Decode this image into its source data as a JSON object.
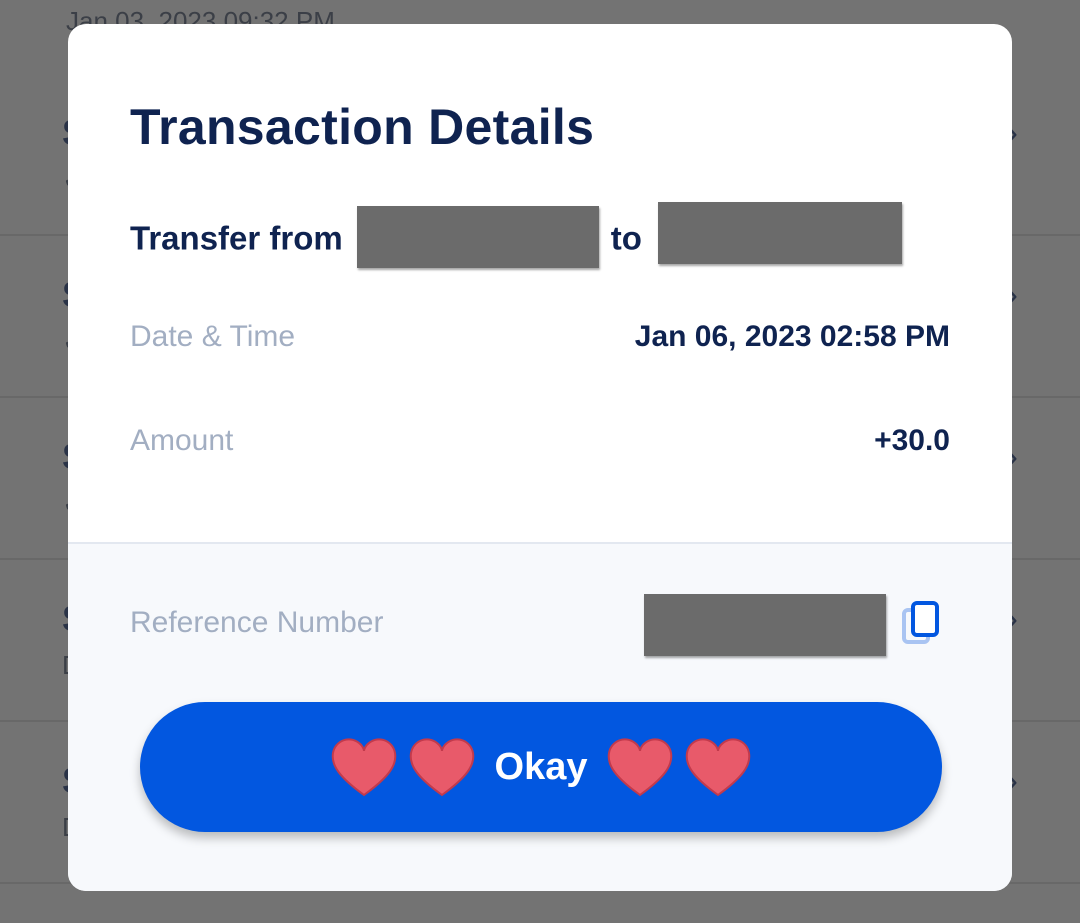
{
  "background": {
    "top_date": "Jan 03, 2023 09:32 PM",
    "rows": [
      {
        "title": "S",
        "chevron": "›",
        "sub": "✓"
      },
      {
        "title": "S",
        "chevron": "›",
        "sub": "✓"
      },
      {
        "title": "S",
        "chevron": "›",
        "sub": "✓"
      },
      {
        "title": "S",
        "chevron": "›",
        "sub": "D"
      },
      {
        "title": "S",
        "chevron": "›",
        "sub": "D"
      }
    ]
  },
  "modal": {
    "title": "Transaction Details",
    "transfer_from": "Transfer from",
    "transfer_to": "to",
    "date_label": "Date & Time",
    "date_value": "Jan 06, 2023 02:58 PM",
    "amount_label": "Amount",
    "amount_value": "+30.0",
    "reference_label": "Reference Number",
    "okay_label": "Okay",
    "icons": {
      "copy": "copy-icon",
      "decoration": "heart-icon"
    },
    "colors": {
      "title": "#0f2350",
      "label": "#a2aec2",
      "button": "#0257e0",
      "heart": "#e85a6a",
      "redaction": "#6b6b6b"
    }
  }
}
